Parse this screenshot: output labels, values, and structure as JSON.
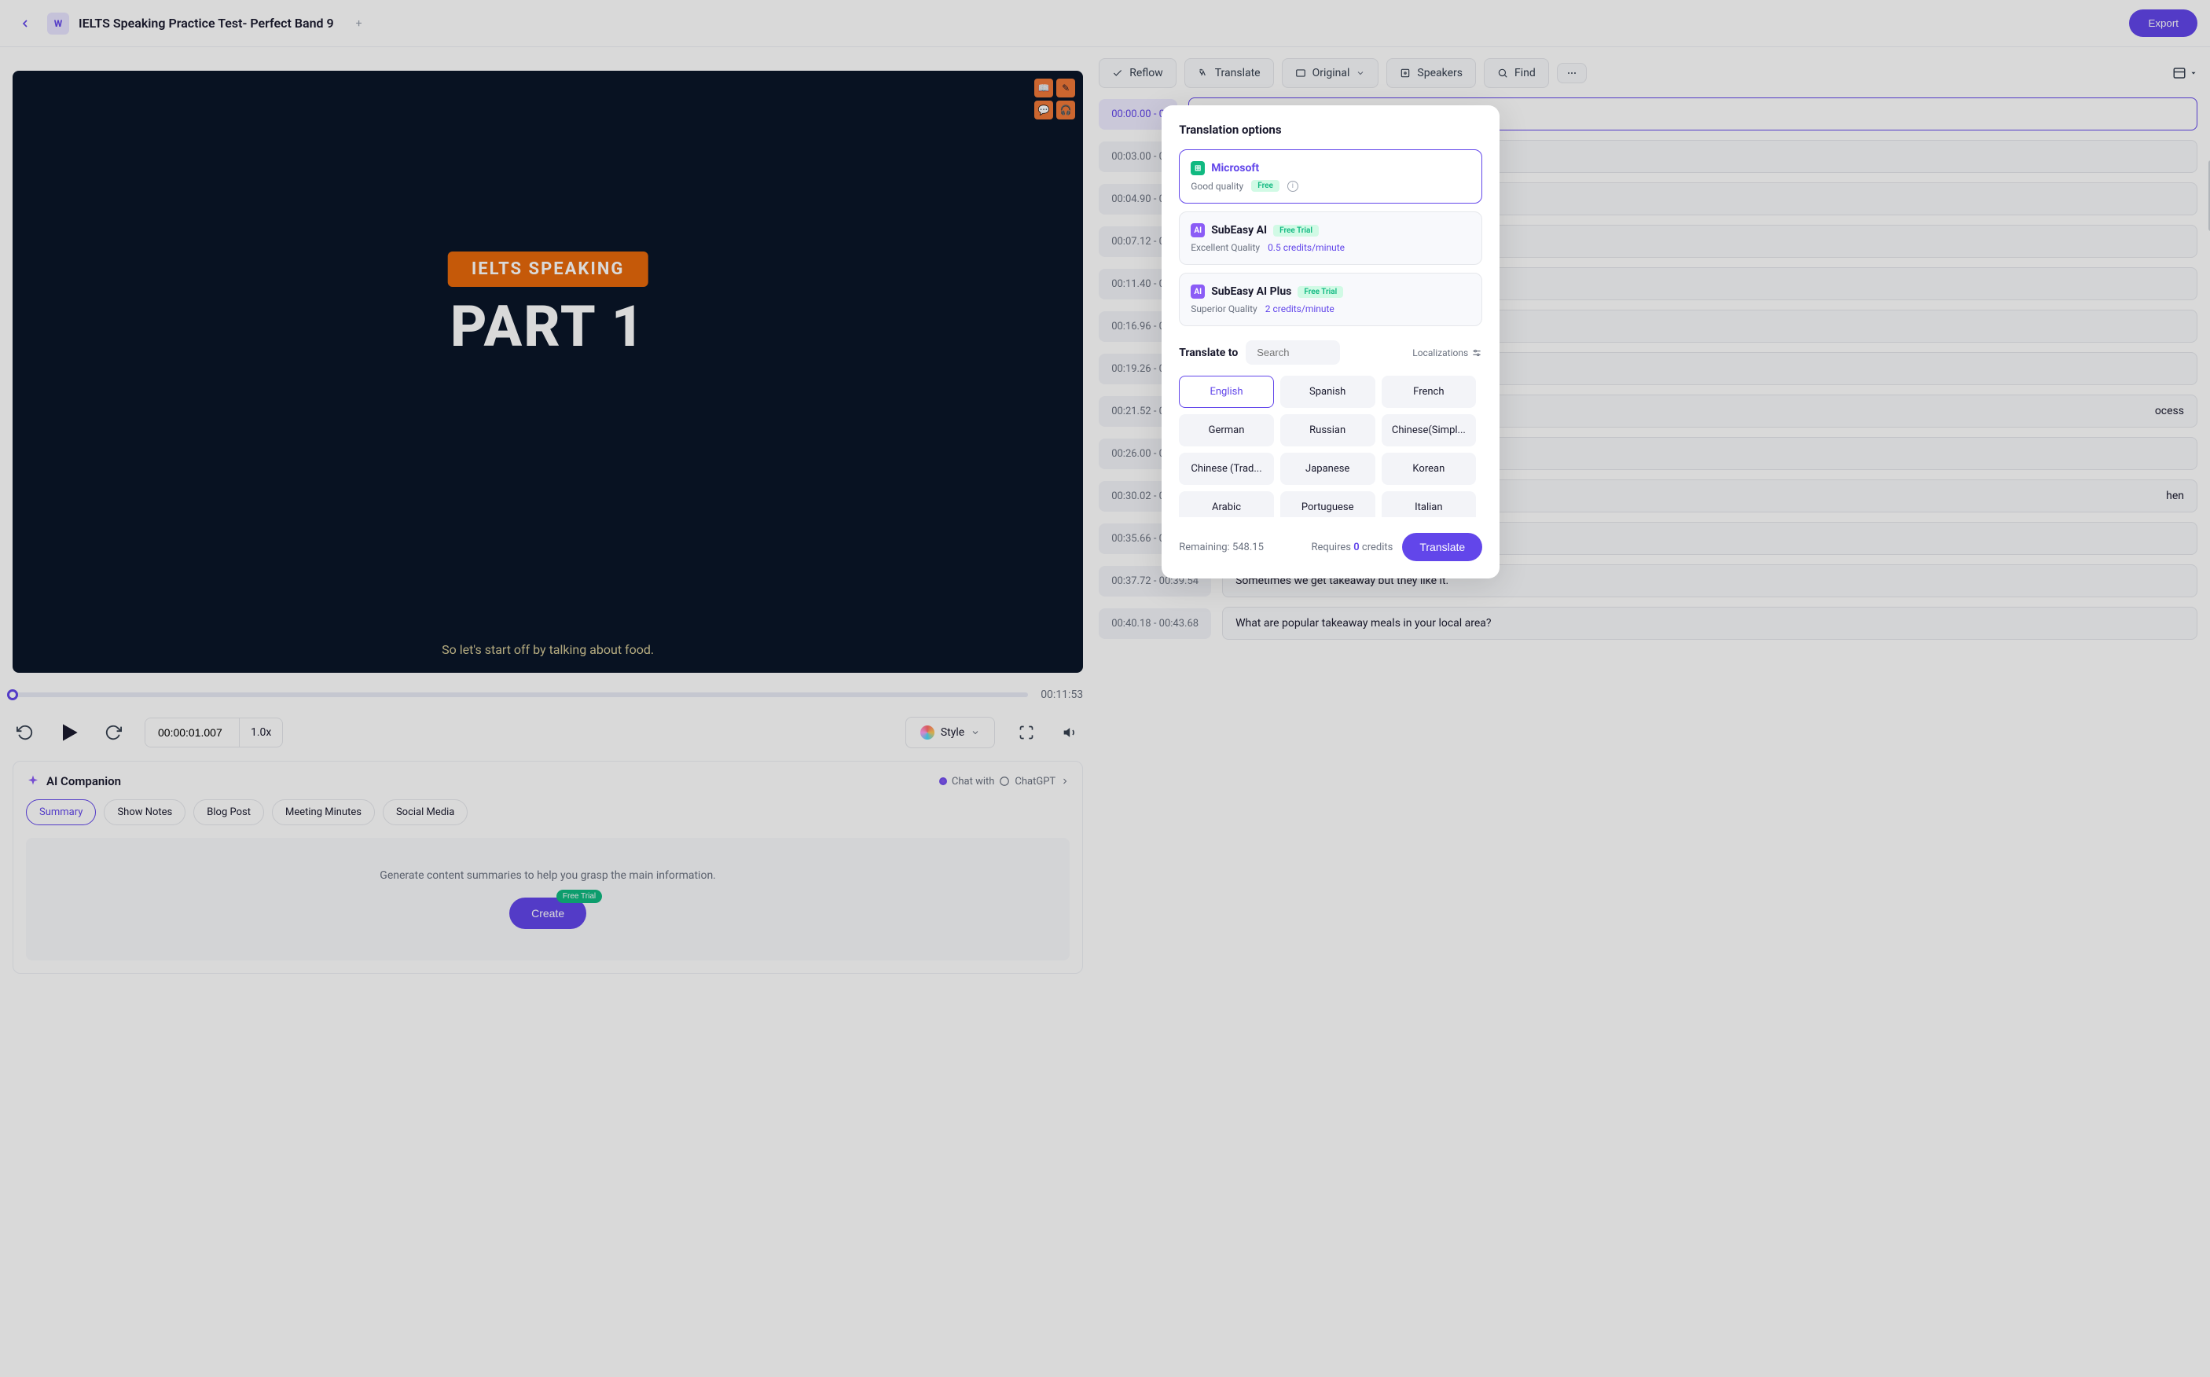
{
  "topbar": {
    "title": "IELTS Speaking Practice Test- Perfect Band 9",
    "export": "Export"
  },
  "video": {
    "ielts_label": "IELTS SPEAKING",
    "part_label": "PART 1",
    "caption": "So let's start off by talking about food.",
    "duration": "00:11:53",
    "timecode": "00:00:01.007",
    "speed": "1.0x"
  },
  "style_btn": "Style",
  "companion": {
    "title": "AI Companion",
    "chat_label": "Chat with",
    "chat_target": "ChatGPT",
    "pills": [
      "Summary",
      "Show Notes",
      "Blog Post",
      "Meeting Minutes",
      "Social Media"
    ],
    "gen_text": "Generate content summaries to help you grasp the main information.",
    "create": "Create",
    "free_trial": "Free Trial"
  },
  "toolbar": {
    "reflow": "Reflow",
    "translate": "Translate",
    "original": "Original",
    "speakers": "Speakers",
    "find": "Find"
  },
  "transcript": [
    {
      "start": "00:00.00",
      "sep": "-",
      "end": "0",
      "text": "",
      "active": true
    },
    {
      "start": "00:03.00",
      "sep": "-",
      "end": "0",
      "text": ""
    },
    {
      "start": "00:04.90",
      "sep": "-",
      "end": "0",
      "text": ""
    },
    {
      "start": "00:07.12",
      "sep": "-",
      "end": "0",
      "text": ""
    },
    {
      "start": "00:11.40",
      "sep": "-",
      "end": "0",
      "text": ""
    },
    {
      "start": "00:16.96",
      "sep": "-",
      "end": "0",
      "text": ""
    },
    {
      "start": "00:19.26",
      "sep": "-",
      "end": "0",
      "text": ""
    },
    {
      "start": "00:21.52",
      "sep": "-",
      "end": "0",
      "text": "ocess"
    },
    {
      "start": "00:26.00",
      "sep": "-",
      "end": "0",
      "text": ""
    },
    {
      "start": "00:30.02",
      "sep": "-",
      "end": "0",
      "text": "hen"
    },
    {
      "start": "00:35.66",
      "sep": "-",
      "end": "0",
      "text": ""
    },
    {
      "start": "00:37.72",
      "sep": "-",
      "end": "00:39.54",
      "text": "Sometimes we get takeaway but they like it."
    },
    {
      "start": "00:40.18",
      "sep": "-",
      "end": "00:43.68",
      "text": "What are popular takeaway meals in your local area?"
    }
  ],
  "modal": {
    "title": "Translation options",
    "options": [
      {
        "name": "Microsoft",
        "sub": "Good quality",
        "badge": "Free",
        "selected": true,
        "icon": "ms"
      },
      {
        "name": "SubEasy AI",
        "sub": "Excellent Quality",
        "credits": "0.5 credits/minute",
        "badge": "Free Trial",
        "icon": "ai"
      },
      {
        "name": "SubEasy AI Plus",
        "sub": "Superior Quality",
        "credits": "2 credits/minute",
        "badge": "Free Trial",
        "icon": "ai"
      }
    ],
    "translate_to": "Translate to",
    "search_placeholder": "Search",
    "localizations": "Localizations",
    "languages": [
      "English",
      "Spanish",
      "French",
      "German",
      "Russian",
      "Chinese(Simplified)",
      "Chinese (Traditional)",
      "Japanese",
      "Korean",
      "Arabic",
      "Portuguese",
      "Italian"
    ],
    "selected_lang": "English",
    "remaining_label": "Remaining:",
    "remaining_value": "548.15",
    "requires_prefix": "Requires",
    "requires_num": "0",
    "requires_suffix": "credits",
    "action": "Translate"
  }
}
